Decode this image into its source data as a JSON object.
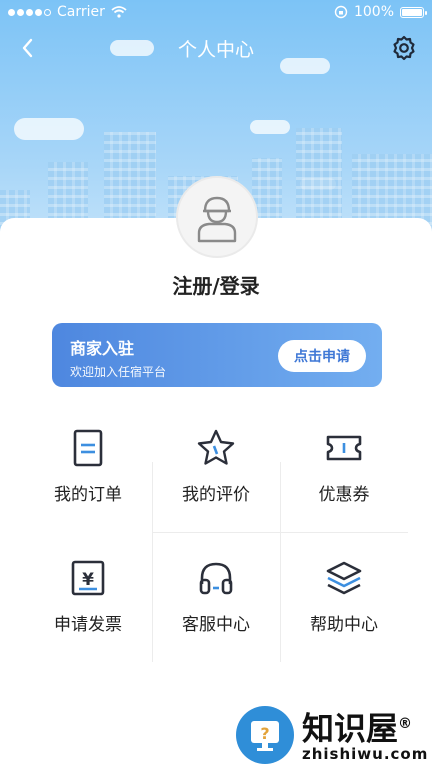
{
  "status_bar": {
    "carrier": "Carrier",
    "battery": "100%"
  },
  "header": {
    "title": "个人中心",
    "back_icon": "chevron-left-icon",
    "settings_icon": "gear-icon"
  },
  "profile": {
    "avatar_icon": "user-avatar-icon",
    "login_label": "注册/登录"
  },
  "merchant_banner": {
    "title": "商家入驻",
    "subtitle": "欢迎加入任宿平台",
    "button_label": "点击申请"
  },
  "menu": [
    {
      "label": "我的订单",
      "icon": "order-icon"
    },
    {
      "label": "我的评价",
      "icon": "star-icon"
    },
    {
      "label": "优惠券",
      "icon": "coupon-icon"
    },
    {
      "label": "申请发票",
      "icon": "invoice-icon"
    },
    {
      "label": "客服中心",
      "icon": "headset-icon"
    },
    {
      "label": "帮助中心",
      "icon": "layers-icon"
    }
  ],
  "watermark": {
    "name": "知识屋",
    "domain": "zhishiwu.com"
  },
  "colors": {
    "sky": "#7cc3f6",
    "banner_start": "#4e87df",
    "banner_end": "#73aef0",
    "icon_dark": "#2b2f3a",
    "icon_accent": "#3d8fe0"
  }
}
